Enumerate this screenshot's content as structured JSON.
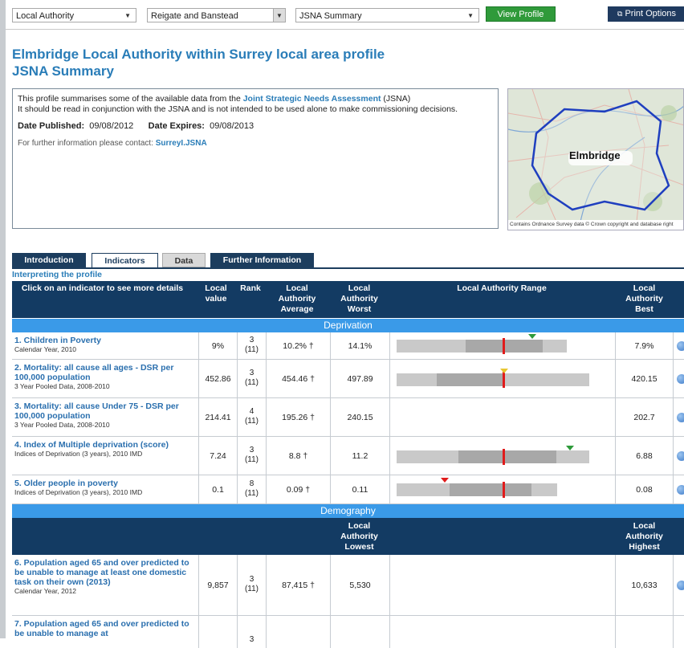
{
  "toolbar": {
    "area_type": "Local Authority",
    "area": "Reigate and Banstead",
    "profile": "JSNA Summary",
    "view_button": "View Profile",
    "print_button": "Print Options"
  },
  "title": {
    "line1": "Elmbridge Local Authority within Surrey local area profile",
    "line2": "JSNA Summary"
  },
  "info": {
    "intro_pre": "This profile summarises some of the available data from the ",
    "intro_link": "Joint Strategic Needs Assessment",
    "intro_post": " (JSNA)",
    "line2": "It should be read in conjunction with the JSNA and is not intended to be used alone to make commissioning decisions.",
    "published_label": "Date Published:",
    "published": "09/08/2012",
    "expires_label": "Date Expires:",
    "expires": "09/08/2013",
    "contact_pre": "For further information please contact: ",
    "contact_link": "SurreyI.JSNA"
  },
  "map": {
    "label": "Elmbridge",
    "credit": "Contains Ordnance Survey data © Crown copyright and database right"
  },
  "tabs": [
    "Introduction",
    "Indicators",
    "Data",
    "Further Information"
  ],
  "interpreting": "Interpreting the profile",
  "header": {
    "indicator": "Click on an indicator to see more details",
    "local_value": "Local value",
    "rank": "Rank",
    "avg": "Local Authority Average",
    "worst": "Local Authority Worst",
    "range": "Local Authority Range",
    "best": "Local Authority Best"
  },
  "sections": {
    "deprivation": "Deprivation",
    "demography": "Demography"
  },
  "header2": {
    "lowest": "Local Authority Lowest",
    "highest": "Local Authority Highest"
  },
  "rows": [
    {
      "title": "1. Children in Poverty",
      "sub": "Calendar Year, 2010",
      "value": "9%",
      "rank": "3",
      "rank_of": "(11)",
      "avg": "10.2% †",
      "worst": "14.1%",
      "best": "7.9%"
    },
    {
      "title": "2. Mortality: all cause all ages - DSR per 100,000 population",
      "sub": "3 Year Pooled Data, 2008-2010",
      "value": "452.86",
      "rank": "3",
      "rank_of": "(11)",
      "avg": "454.46 †",
      "worst": "497.89",
      "best": "420.15"
    },
    {
      "title": "3. Mortality: all cause Under 75 - DSR per 100,000 population",
      "sub": "3 Year Pooled Data, 2008-2010",
      "value": "214.41",
      "rank": "4",
      "rank_of": "(11)",
      "avg": "195.26 †",
      "worst": "240.15",
      "best": "202.7"
    },
    {
      "title": "4. Index of Multiple deprivation (score)",
      "sub": "Indices of Deprivation (3 years), 2010 IMD",
      "value": "7.24",
      "rank": "3",
      "rank_of": "(11)",
      "avg": "8.8 †",
      "worst": "11.2",
      "best": "6.88"
    },
    {
      "title": "5. Older people in poverty",
      "sub": "Indices of Deprivation (3 years), 2010 IMD",
      "value": "0.1",
      "rank": "8",
      "rank_of": "(11)",
      "avg": "0.09 †",
      "worst": "0.11",
      "best": "0.08"
    },
    {
      "title": "6. Population aged 65 and over predicted to be unable to manage at least one domestic task on their own (2013)",
      "sub": "Calendar Year, 2012",
      "value": "9,857",
      "rank": "3",
      "rank_of": "(11)",
      "avg": "87,415 †",
      "worst": "5,530",
      "best": "10,633"
    },
    {
      "title": "7. Population aged 65 and over predicted to be unable to manage at",
      "sub": "",
      "value": "",
      "rank": "3",
      "rank_of": "",
      "avg": "",
      "worst": "",
      "best": ""
    }
  ],
  "colors": {
    "marker_green": "#2e9a3a",
    "marker_yellow": "#e8c630",
    "marker_red": "#e01b1b",
    "header_bg": "#133b63",
    "section_bg": "#3a9ae8"
  }
}
